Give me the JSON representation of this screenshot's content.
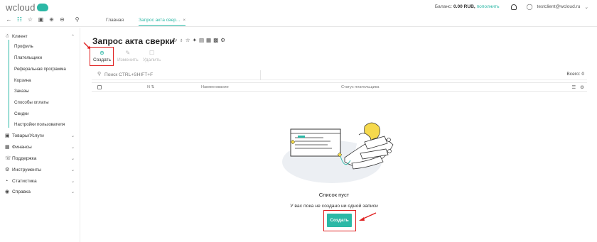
{
  "app": {
    "logo_text": "wcloud"
  },
  "topbar": {
    "balance_label": "Баланс:",
    "balance_value": "0.00 RUB,",
    "topup_link": "пополнить",
    "user": "testclient@wcloud.ru"
  },
  "tabs": [
    {
      "label": "Главная"
    },
    {
      "label": "Запрос акта свер...",
      "close": "×"
    }
  ],
  "sidebar": {
    "client": {
      "label": "Клиент",
      "icon": "user-icon"
    },
    "client_items": [
      {
        "label": "Профиль"
      },
      {
        "label": "Плательщики"
      },
      {
        "label": "Реферальная программа"
      },
      {
        "label": "Корзина"
      },
      {
        "label": "Заказы"
      },
      {
        "label": "Способы оплаты"
      },
      {
        "label": "Скидки"
      },
      {
        "label": "Настройки пользователя"
      }
    ],
    "sections": [
      {
        "label": "Товары/Услуги",
        "icon": "box-icon"
      },
      {
        "label": "Финансы",
        "icon": "wallet-icon"
      },
      {
        "label": "Поддержка",
        "icon": "support-icon"
      },
      {
        "label": "Инструменты",
        "icon": "gear-icon"
      },
      {
        "label": "Статистика",
        "icon": "chart-icon"
      },
      {
        "label": "Справка",
        "icon": "help-icon"
      }
    ]
  },
  "page": {
    "title": "Запрос акта сверки",
    "actions": {
      "create": "Создать",
      "edit": "Изменить",
      "delete": "Удалить"
    }
  },
  "search": {
    "placeholder": "Поиск CTRL+SHIFT+F",
    "total": "Всего: 0"
  },
  "table": {
    "columns": [
      "N",
      "Наименование",
      "Статус плательщика"
    ]
  },
  "empty": {
    "title": "Список пуст",
    "subtitle": "У вас пока не создано ни одной записи",
    "button": "Создать"
  },
  "colors": {
    "accent": "#2cb8a6",
    "annotation": "#e02020"
  }
}
